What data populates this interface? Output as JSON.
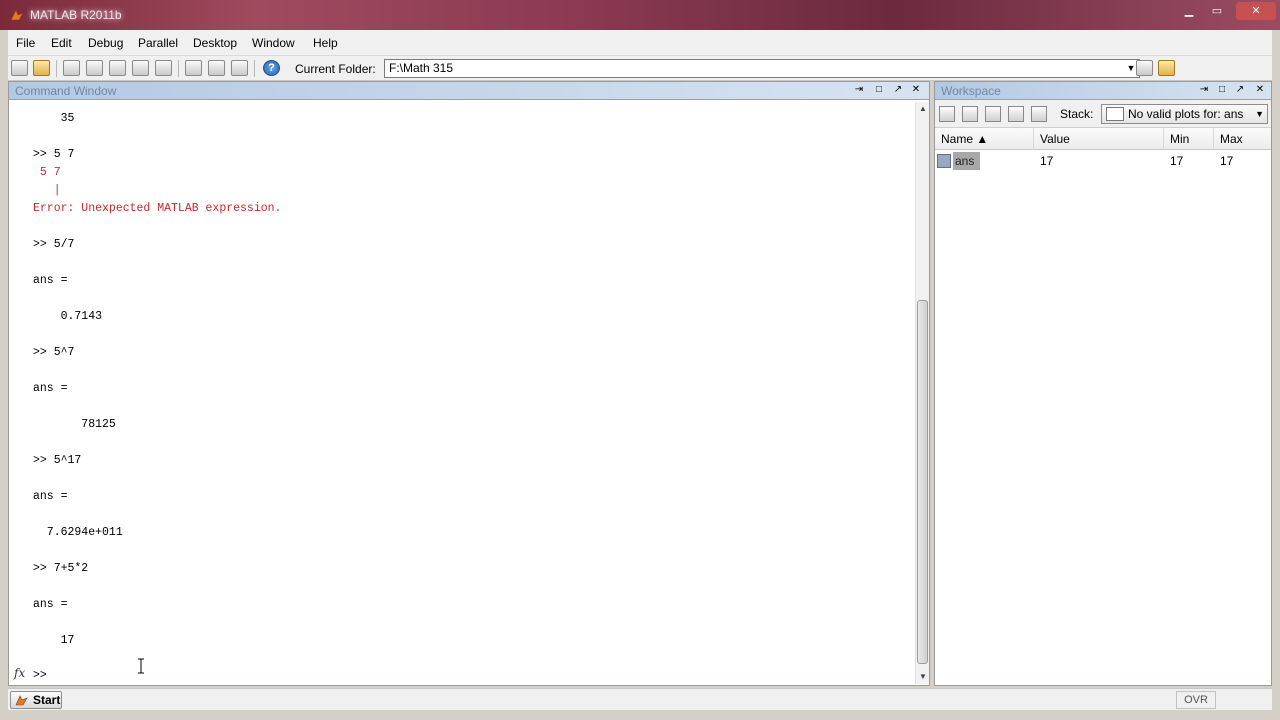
{
  "window": {
    "title": "MATLAB R2011b",
    "min_icon": "minimize-icon",
    "max_icon": "maximize-icon",
    "close_icon": "close-icon"
  },
  "menu": [
    "File",
    "Edit",
    "Debug",
    "Parallel",
    "Desktop",
    "Window",
    "Help"
  ],
  "toolbar": {
    "current_folder_label": "Current Folder:",
    "current_folder_value": "F:\\Math 315",
    "help_glyph": "?"
  },
  "command_window": {
    "title": "Command Window",
    "lines": [
      {
        "text": "    35",
        "type": "output"
      },
      {
        "text": "",
        "type": "output"
      },
      {
        "text": ">> 5 7",
        "type": "input"
      },
      {
        "text": " 5 7",
        "type": "error"
      },
      {
        "text": "   |",
        "type": "error"
      },
      {
        "text": "Error: Unexpected MATLAB expression.",
        "type": "error"
      },
      {
        "text": "",
        "type": "output"
      },
      {
        "text": ">> 5/7",
        "type": "input"
      },
      {
        "text": "",
        "type": "output"
      },
      {
        "text": "ans =",
        "type": "output"
      },
      {
        "text": "",
        "type": "output"
      },
      {
        "text": "    0.7143",
        "type": "output"
      },
      {
        "text": "",
        "type": "output"
      },
      {
        "text": ">> 5^7",
        "type": "input"
      },
      {
        "text": "",
        "type": "output"
      },
      {
        "text": "ans =",
        "type": "output"
      },
      {
        "text": "",
        "type": "output"
      },
      {
        "text": "       78125",
        "type": "output"
      },
      {
        "text": "",
        "type": "output"
      },
      {
        "text": ">> 5^17",
        "type": "input"
      },
      {
        "text": "",
        "type": "output"
      },
      {
        "text": "ans =",
        "type": "output"
      },
      {
        "text": "",
        "type": "output"
      },
      {
        "text": "  7.6294e+011",
        "type": "output"
      },
      {
        "text": "",
        "type": "output"
      },
      {
        "text": ">> 7+5*2",
        "type": "input"
      },
      {
        "text": "",
        "type": "output"
      },
      {
        "text": "ans =",
        "type": "output"
      },
      {
        "text": "",
        "type": "output"
      },
      {
        "text": "    17",
        "type": "output"
      }
    ],
    "prompt": ">>",
    "fx_glyph": "fx"
  },
  "workspace": {
    "title": "Workspace",
    "stack_label": "Stack:",
    "plot_select_value": "No valid plots for: ans",
    "columns": [
      "Name ▲",
      "Value",
      "Min",
      "Max"
    ],
    "variables": [
      {
        "name": "ans",
        "value": "17",
        "min": "17",
        "max": "17"
      }
    ]
  },
  "statusbar": {
    "start_label": "Start",
    "ovr_label": "OVR"
  },
  "colors": {
    "error_text": "#c82a2a",
    "panel_title_text": "#6d88a8",
    "title_bar": "#8a3a52"
  }
}
